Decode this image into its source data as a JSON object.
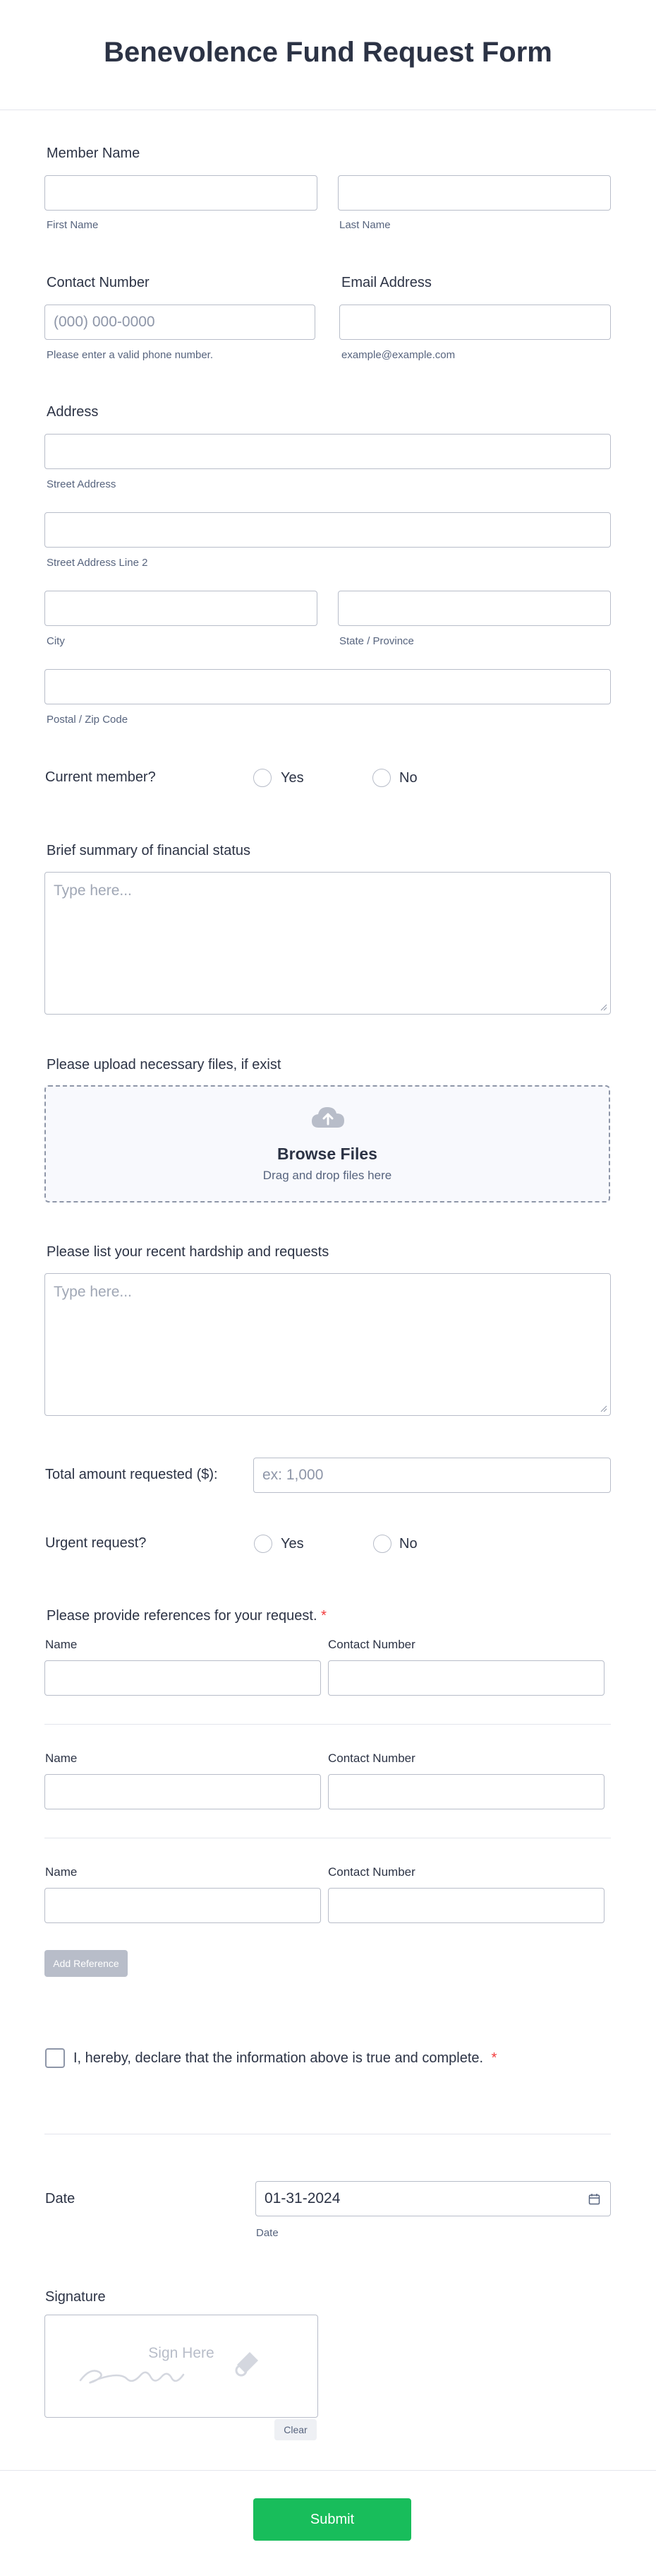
{
  "form": {
    "title": "Benevolence Fund Request Form"
  },
  "member_name": {
    "label": "Member Name",
    "first_sublabel": "First Name",
    "last_sublabel": "Last Name",
    "first_value": "",
    "last_value": ""
  },
  "contact": {
    "label": "Contact Number",
    "placeholder": "(000) 000-0000",
    "sublabel": "Please enter a valid phone number."
  },
  "email": {
    "label": "Email Address",
    "value": "",
    "sublabel": "example@example.com"
  },
  "address": {
    "label": "Address",
    "street_sublabel": "Street Address",
    "street2_sublabel": "Street Address Line 2",
    "city_sublabel": "City",
    "state_sublabel": "State / Province",
    "postal_sublabel": "Postal / Zip Code"
  },
  "current_member": {
    "label": "Current member?",
    "options": [
      "Yes",
      "No"
    ]
  },
  "financial_status": {
    "label": "Brief summary of financial status",
    "placeholder": "Type here..."
  },
  "upload": {
    "label": "Please upload necessary files, if exist",
    "button": "Browse Files",
    "hint": "Drag and drop files here"
  },
  "hardship": {
    "label": "Please list your recent hardship and requests",
    "placeholder": "Type here..."
  },
  "amount": {
    "label": "Total amount requested ($):",
    "placeholder": "ex: 1,000"
  },
  "urgent": {
    "label": "Urgent request?",
    "options": [
      "Yes",
      "No"
    ]
  },
  "references": {
    "label": "Please provide references for your request.",
    "required_mark": "*",
    "col_name": "Name",
    "col_contact": "Contact Number",
    "add_button": "Add Reference"
  },
  "declaration": {
    "text": "I, hereby, declare that the information above is true and complete.",
    "required_mark": "*"
  },
  "date": {
    "label": "Date",
    "value": "01-31-2024",
    "sublabel": "Date"
  },
  "signature": {
    "label": "Signature",
    "prompt": "Sign Here",
    "clear_button": "Clear"
  },
  "submit": {
    "label": "Submit"
  },
  "colors": {
    "submit": "#18bd5b",
    "text": "#2c3345",
    "border": "#b8bdc9",
    "required": "#f23a3c"
  }
}
